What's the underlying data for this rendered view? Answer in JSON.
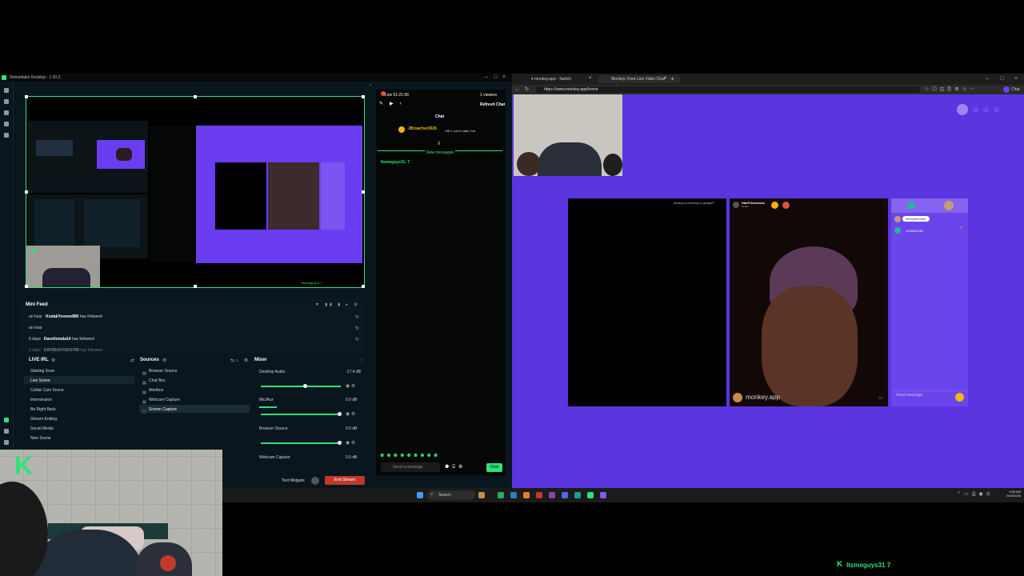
{
  "streamlabs": {
    "window_title": "Streamlabs Desktop - 1.20.0",
    "live_status": "Live 01:21:06",
    "viewers": "1 viewers",
    "refresh_chat": "Refresh Chat",
    "mini_feed": {
      "title": "Mini Feed",
      "rows": [
        {
          "time": "an hour",
          "user": "KodakYovnne880",
          "action": "has followed"
        },
        {
          "time": "an hour",
          "user": "",
          "action": ""
        },
        {
          "time": "6 days",
          "user": "Davellomda14",
          "action": "has followed"
        },
        {
          "time": "6 days",
          "user": "DAVIBADYAO0768",
          "action": "has followed"
        }
      ]
    },
    "scenes": {
      "title": "LIVE IRL",
      "items": [
        "Starting Soon",
        "Live Scene",
        "Collab Cam Scene",
        "Intermission",
        "Be Right Back",
        "Stream Ending",
        "Social Media",
        "New Scene"
      ],
      "active_index": 1
    },
    "sources": {
      "title": "Sources",
      "items": [
        "Browser Source",
        "Chat Box",
        "Alertbox",
        "Webcam Capture",
        "Screen Capture"
      ],
      "selected_index": 4
    },
    "mixer": {
      "title": "Mixer",
      "channels": [
        {
          "name": "Desktop Audio",
          "value": "-17.4 dB",
          "level": 0.55
        },
        {
          "name": "Mic/Aux",
          "value": "0.0 dB",
          "level": 1.0
        },
        {
          "name": "Browser Source",
          "value": "0.0 dB",
          "level": 1.0
        },
        {
          "name": "Webcam Capture",
          "value": "0.0 dB",
          "level": 1.0
        }
      ]
    },
    "test_widgets": "Test Widgets",
    "end_stream": "End Stream",
    "chat": {
      "title": "Chat",
      "message_user": "JBroacher2026",
      "message_text": "Gift 1 sub to take 2nd",
      "new_messages": "New messages",
      "chat_line": "Itsmeguys31: 7",
      "input_placeholder": "Send a message",
      "send_label": "Chat",
      "send_color": "#2ee37a"
    },
    "preview_caption": "Itsmeguys31 7"
  },
  "browser": {
    "tabs": [
      "monkey.app - Switch",
      "Monkey: Free Live Video Chat"
    ],
    "url": "https://www.monkey.app/home",
    "profile_label": "Chat",
    "video_left_label": "ehbslq-cl-ewxsbg-cl-gollgsPl",
    "user_name": "StarPrincessss",
    "user_sub": "Noods",
    "brand": "monkey.app",
    "sidebar_chip": "mercyforevder",
    "sidebar_code": "4133049152",
    "send_message_placeholder": "Send message",
    "accent": "#5b35e0"
  },
  "taskbar": {
    "search_label": "Search",
    "time": "4:56 AM",
    "date": "9/16/2026"
  },
  "overlay": {
    "bottom_caption": "Itsmeguys31 7",
    "logo_letter": "K"
  }
}
